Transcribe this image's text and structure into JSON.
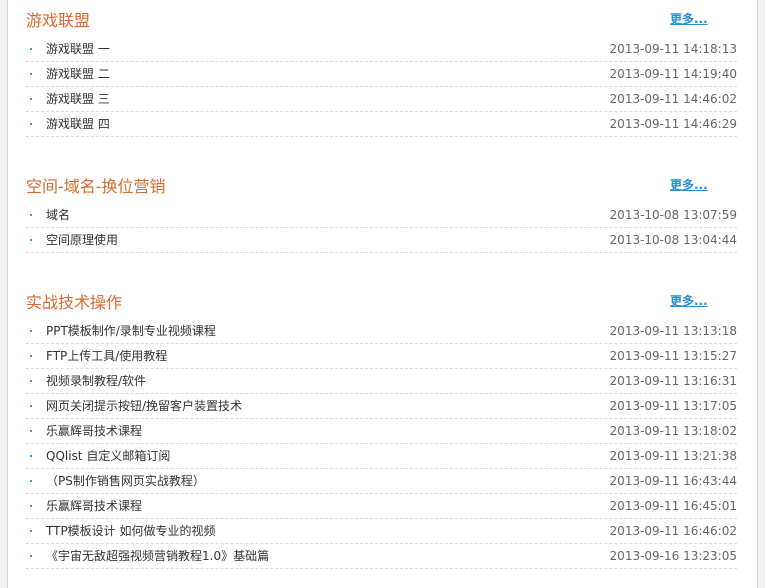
{
  "sections": [
    {
      "title": "游戏联盟",
      "more": "更多...",
      "items": [
        {
          "title": "游戏联盟 一",
          "time": "2013-09-11 14:18:13"
        },
        {
          "title": "游戏联盟 二",
          "time": "2013-09-11 14:19:40"
        },
        {
          "title": "游戏联盟 三",
          "time": "2013-09-11 14:46:02"
        },
        {
          "title": "游戏联盟 四",
          "time": "2013-09-11 14:46:29"
        }
      ]
    },
    {
      "title": "空间-域名-换位营销",
      "more": "更多...",
      "items": [
        {
          "title": "域名",
          "time": "2013-10-08 13:07:59"
        },
        {
          "title": "空间原理使用",
          "time": "2013-10-08 13:04:44"
        }
      ]
    },
    {
      "title": "实战技术操作",
      "more": "更多...",
      "items": [
        {
          "title": "PPT模板制作/录制专业视频课程",
          "time": "2013-09-11 13:13:18"
        },
        {
          "title": "FTP上传工具/使用教程",
          "time": "2013-09-11 13:15:27"
        },
        {
          "title": "视频录制教程/软件",
          "time": "2013-09-11 13:16:31"
        },
        {
          "title": "网页关闭提示按钮/挽留客户装置技术",
          "time": "2013-09-11 13:17:05"
        },
        {
          "title": "乐赢辉哥技术课程",
          "time": "2013-09-11 13:18:02"
        },
        {
          "title": "QQlist 自定义邮箱订阅",
          "time": "2013-09-11 13:21:38"
        },
        {
          "title": "（PS制作销售网页实战教程）",
          "time": "2013-09-11 16:43:44"
        },
        {
          "title": "乐赢辉哥技术课程",
          "time": "2013-09-11 16:45:01"
        },
        {
          "title": "TTP模板设计 如何做专业的视频",
          "time": "2013-09-11 16:46:02"
        },
        {
          "title": "《宇宙无敌超强视频营销教程1.0》基础篇",
          "time": "2013-09-16 13:23:05"
        }
      ]
    }
  ]
}
